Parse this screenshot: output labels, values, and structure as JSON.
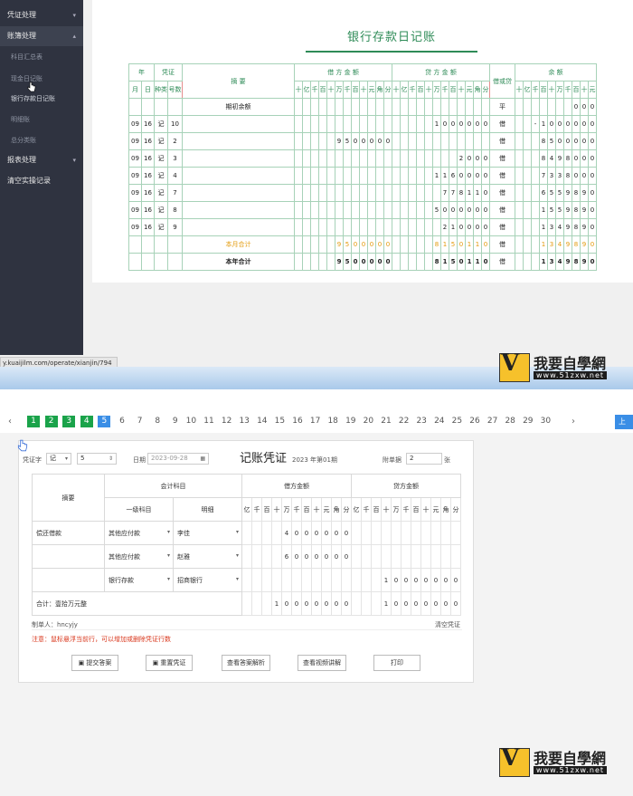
{
  "top": {
    "sidebar": {
      "items": [
        {
          "label": "凭证处理",
          "chevron": "▾"
        },
        {
          "label": "账簿处理",
          "chevron": "▴"
        },
        {
          "label": "科目汇总表"
        },
        {
          "label": "现金日记账"
        },
        {
          "label": "银行存款日记账"
        },
        {
          "label": "明细账"
        },
        {
          "label": "总分类账"
        },
        {
          "label": "报表处理",
          "chevron": "▾"
        },
        {
          "label": "清空实操记录"
        }
      ]
    },
    "ledger": {
      "title": "银行存款日记账",
      "headers": {
        "year": "年",
        "voucher": "凭证",
        "month": "月",
        "day": "日",
        "kind": "种类",
        "number": "号数",
        "summary": "摘 要",
        "debit": "借 方 金 额",
        "credit": "贷 方 金 额",
        "dc": "借或贷",
        "balance": "余 额",
        "digits_cr": [
          "十",
          "亿",
          "千",
          "百",
          "十",
          "万",
          "千",
          "百",
          "十",
          "元",
          "角",
          "分"
        ],
        "digits_bal": [
          "十",
          "亿",
          "千",
          "百",
          "十",
          "万",
          "千",
          "百"
        ]
      },
      "rows": [
        {
          "m": "",
          "d": "",
          "k": "",
          "n": "",
          "summary": "期初余额",
          "debit": "",
          "credit": "",
          "dc": "平",
          "balance": "000",
          "style": ""
        },
        {
          "m": "09",
          "d": "16",
          "k": "记",
          "n": "10",
          "summary": "",
          "debit": "",
          "credit": "1000000",
          "dc": "借",
          "balance": "-1000000",
          "style": ""
        },
        {
          "m": "09",
          "d": "16",
          "k": "记",
          "n": "2",
          "summary": "",
          "debit": "9500000",
          "credit": "",
          "dc": "借",
          "balance": "8500000",
          "style": ""
        },
        {
          "m": "09",
          "d": "16",
          "k": "记",
          "n": "3",
          "summary": "",
          "debit": "",
          "credit": "2000",
          "dc": "借",
          "balance": "8498000",
          "style": ""
        },
        {
          "m": "09",
          "d": "16",
          "k": "记",
          "n": "4",
          "summary": "",
          "debit": "",
          "credit": "1160000",
          "dc": "借",
          "balance": "7338000",
          "style": ""
        },
        {
          "m": "09",
          "d": "16",
          "k": "记",
          "n": "7",
          "summary": "",
          "debit": "",
          "credit": "778110",
          "dc": "借",
          "balance": "6559890",
          "style": ""
        },
        {
          "m": "09",
          "d": "16",
          "k": "记",
          "n": "8",
          "summary": "",
          "debit": "",
          "credit": "5000000",
          "dc": "借",
          "balance": "1559890",
          "style": ""
        },
        {
          "m": "09",
          "d": "16",
          "k": "记",
          "n": "9",
          "summary": "",
          "debit": "",
          "credit": "210000",
          "dc": "借",
          "balance": "1349890",
          "style": ""
        },
        {
          "m": "",
          "d": "",
          "k": "",
          "n": "",
          "summary": "本月合计",
          "debit": "9500000",
          "credit": "8150110",
          "dc": "借",
          "balance": "1349890",
          "style": "orange"
        },
        {
          "m": "",
          "d": "",
          "k": "",
          "n": "",
          "summary": "本年合计",
          "debit": "9500000",
          "credit": "8150110",
          "dc": "借",
          "balance": "1349890",
          "style": "bold"
        }
      ]
    },
    "url": "y.kuaijilm.com/operate/xianjin/794",
    "watermark": {
      "title": "我要自學網",
      "sub": "www.51zxw.net",
      "v": "V"
    }
  },
  "bottom": {
    "pager": {
      "prev": "‹",
      "next": "›",
      "pages": [
        "1",
        "2",
        "3",
        "4",
        "5",
        "6",
        "7",
        "8",
        "9",
        "10",
        "11",
        "12",
        "13",
        "14",
        "15",
        "16",
        "17",
        "18",
        "19",
        "20",
        "21",
        "22",
        "23",
        "24",
        "25",
        "26",
        "27",
        "28",
        "29",
        "30"
      ],
      "done_count": 4,
      "current": "5",
      "right_button": "上"
    },
    "voucher": {
      "word_label": "凭证字",
      "word_value": "记",
      "number_value": "5",
      "date_label": "日期",
      "date_value": "2023-09-28",
      "title": "记账凭证",
      "period": "2023 年第01期",
      "attach_label": "附单据",
      "attach_value": "2",
      "attach_unit": "张",
      "headers": {
        "summary": "摘要",
        "account": "会计科目",
        "level1": "一级科目",
        "detail": "明细",
        "debit": "借方金额",
        "credit": "贷方金额",
        "digits": [
          "亿",
          "千",
          "百",
          "十",
          "万",
          "千",
          "百",
          "十",
          "元",
          "角",
          "分"
        ]
      },
      "lines": [
        {
          "summary": "偿还借款",
          "level1": "其他应付款",
          "detail": "李佳",
          "debit": "4000000",
          "credit": ""
        },
        {
          "summary": "",
          "level1": "其他应付款",
          "detail": "赵雅",
          "debit": "6000000",
          "credit": ""
        },
        {
          "summary": "",
          "level1": "银行存款",
          "detail": "招商银行",
          "debit": "",
          "credit": "10000000"
        }
      ],
      "total_label": "合计：壹拾万元整",
      "total_debit": "10000000",
      "total_credit": "10000000",
      "maker": "制单人：hncyjy",
      "clear": "清空凭证",
      "note": "注意：鼠标悬浮当前行，可以增加或删除凭证行数",
      "buttons": [
        "提交答案",
        "重置凭证",
        "查看答案解析",
        "查看视频讲解",
        "打印"
      ]
    },
    "watermark": {
      "title": "我要自學網",
      "sub": "www.51zxw.net",
      "v": "V"
    }
  },
  "colors": {
    "green": "#2e8b57",
    "done": "#1aa34a",
    "current": "#3a8ee6",
    "note": "#d9381e",
    "sidebar": "#2f3340"
  }
}
